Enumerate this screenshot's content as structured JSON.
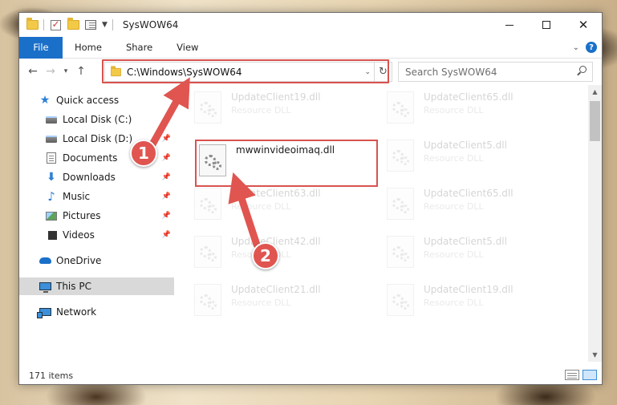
{
  "window": {
    "title": "SysWOW64",
    "controls": {
      "minimize": "minimize",
      "maximize": "maximize",
      "close": "✕"
    }
  },
  "ribbon": {
    "tabs": [
      {
        "label": "File"
      },
      {
        "label": "Home"
      },
      {
        "label": "Share"
      },
      {
        "label": "View"
      }
    ]
  },
  "address": {
    "path": "C:\\Windows\\SysWOW64",
    "search_placeholder": "Search SysWOW64"
  },
  "nav_pane": {
    "items": [
      {
        "label": "Quick access",
        "icon": "star-icon"
      },
      {
        "label": "Local Disk (C:)",
        "icon": "disk-icon"
      },
      {
        "label": "Local Disk (D:)",
        "icon": "disk-icon"
      },
      {
        "label": "Documents",
        "icon": "documents-icon"
      },
      {
        "label": "Downloads",
        "icon": "downloads-icon"
      },
      {
        "label": "Music",
        "icon": "music-icon"
      },
      {
        "label": "Pictures",
        "icon": "pictures-icon"
      },
      {
        "label": "Videos",
        "icon": "videos-icon"
      },
      {
        "label": "OneDrive",
        "icon": "onedrive-icon"
      },
      {
        "label": "This PC",
        "icon": "this-pc-icon",
        "selected": true
      },
      {
        "label": "Network",
        "icon": "network-icon"
      }
    ]
  },
  "files": {
    "highlighted": {
      "name": "mwwinvideoimaq.dll",
      "type": ""
    },
    "background": [
      {
        "name": "UpdateClient19.dll",
        "type": "Resource DLL"
      },
      {
        "name": "UpdateClient65.dll",
        "type": "Resource DLL"
      },
      {
        "name": "UpdateClient5.dll",
        "type": "Resource DLL"
      },
      {
        "name": "UpdateClient63.dll",
        "type": "Resource DLL"
      },
      {
        "name": "UpdateClient65.dll",
        "type": "Resource DLL"
      },
      {
        "name": "UpdateClient42.dll",
        "type": "Resource DLL"
      },
      {
        "name": "UpdateClient5.dll",
        "type": "Resource DLL"
      },
      {
        "name": "UpdateClient21.dll",
        "type": "Resource DLL"
      },
      {
        "name": "UpdateClient19.dll",
        "type": "Resource DLL"
      }
    ]
  },
  "status": {
    "item_count": "171 items"
  },
  "callouts": [
    {
      "label": "1"
    },
    {
      "label": "2"
    }
  ],
  "colors": {
    "accent": "#1a70c9",
    "highlight": "#d9534f",
    "callout": "#e05550"
  }
}
